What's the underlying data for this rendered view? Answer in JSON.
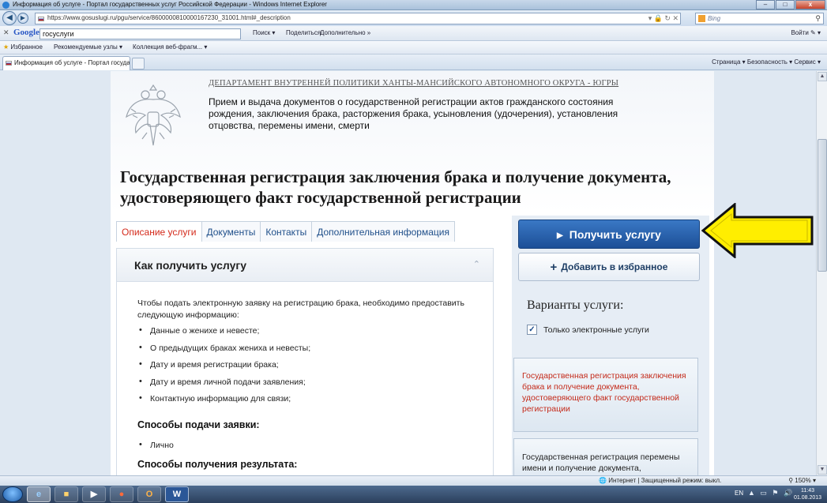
{
  "window": {
    "title": "Информация об услуге - Портал государственных услуг Российской Федерации - Windows Internet Explorer",
    "btn_min": "–",
    "btn_max": "□",
    "btn_close": "x"
  },
  "addressbar": {
    "url": "https://www.gosuslugi.ru/pgu/service/8600000810000167230_31001.html#_description",
    "search_placeholder": "Bing"
  },
  "googlebar": {
    "logo": "Google",
    "query": "госуслуги",
    "search_label": "Поиск ▾",
    "share_label": "Поделиться",
    "more_label": "Дополнительно »",
    "signin_label": "Войти ✎ ▾"
  },
  "favorites": {
    "label": "Избранное",
    "items": [
      "Рекомендуемые узлы ▾",
      "Коллекция веб-фрагм... ▾"
    ]
  },
  "tabs_browser": {
    "active_tab": "Информация об услуге - Портал государствен...",
    "command_bar": "Страница ▾   Безопасность ▾   Сервис ▾"
  },
  "header": {
    "department": "ДЕПАРТАМЕНТ ВНУТРЕННЕЙ ПОЛИТИКИ ХАНТЫ-МАНСИЙСКОГО АВТОНОМНОГО ОКРУГА - ЮГРЫ",
    "service_description": "Прием и выдача документов о государственной регистрации актов гражданского состояния рождения, заключения брака, расторжения брака, усыновления (удочерения), установления отцовства, перемены имени, смерти"
  },
  "main": {
    "title": "Государственная регистрация заключения брака и получение документа, удостоверяющего факт государственной регистрации",
    "tabs": [
      {
        "label": "Описание услуги"
      },
      {
        "label": "Документы"
      },
      {
        "label": "Контакты"
      },
      {
        "label": "Дополнительная информация"
      }
    ],
    "section_title": "Как получить услугу",
    "intro": "Чтобы подать электронную заявку на регистрацию брака, необходимо предоставить следующую информацию:",
    "bullets": [
      "Данные о женихе и невесте;",
      "О предыдущих браках жениха и невесты;",
      "Дату и время регистрации брака;",
      "Дату и время личной подачи заявления;",
      "Контактную информацию для связи;"
    ],
    "submit_methods_title": "Способы подачи заявки:",
    "submit_methods": [
      "Лично"
    ],
    "result_methods_title": "Способы получения результата:"
  },
  "sidebar": {
    "get_service": "Получить услугу",
    "add_favorite": "Добавить в избранное",
    "variants_title": "Варианты услуги:",
    "only_electronic": "Только электронные услуги",
    "only_electronic_checked": true,
    "variants": [
      "Государственная регистрация заключения брака и получение документа, удостоверяющего факт государственной регистрации",
      "Государственная регистрация перемены имени и получение документа,"
    ]
  },
  "statusbar": {
    "zone": "Интернет | Защищенный режим: выкл.",
    "zoom": "150%"
  },
  "taskbar": {
    "lang": "EN",
    "time": "11:43",
    "date": "01.08.2013"
  },
  "colors": {
    "primary_button": "#1c4f97",
    "active_tab": "#d42a1b",
    "link": "#1f4f8a",
    "annotation_arrow": "#ffee00"
  }
}
